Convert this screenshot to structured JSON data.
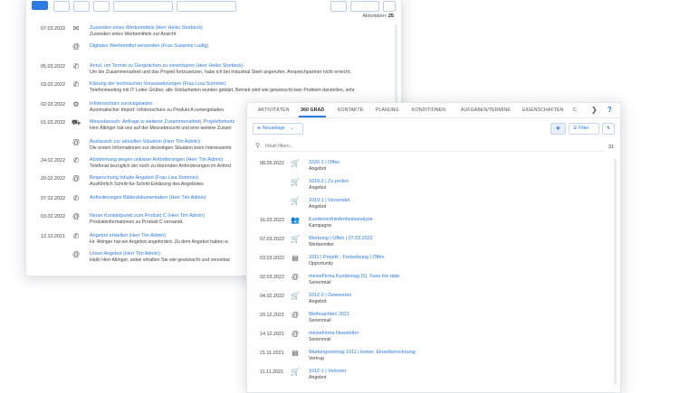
{
  "back_panel": {
    "count_label": "Aktivitäten:",
    "count_value": "25",
    "activities": [
      {
        "date": "07.03.2022",
        "icon": "mail-icon",
        "title": "Zusenden eines Werbemittels (Herr Heiko Storbeck)",
        "desc": "Zusenden eines Werbemittels zur Ansicht"
      },
      {
        "date": "",
        "icon": "at-icon",
        "title": "Digitales Werbemittel versenden (Frau Susanne Ludig)",
        "desc": ""
      },
      {
        "date": "05.03.2022",
        "icon": "phone-icon",
        "title": "Anruf, um Termin zu Gesprächen zu vereinbaren (Herr Heiko Storbeck)",
        "desc": "Um die Zusammenarbeit und das Projekt fortzusetzen, habe ich bei Industrial Steel angerufen.  Ansprechpartner nicht erreicht,"
      },
      {
        "date": "03.03.2022",
        "icon": "phone-icon",
        "title": "Klärung der technischen Voraussetzungen (Frau Lisa Sommer)",
        "desc": "Telefonmeeting mit IT Leiter Grüber, alle Unklarheiten wurden geklärt, Betrieb wird wie gewünscht kein Problem darstellen, sehr"
      },
      {
        "date": "02.03.2022",
        "icon": "settings-icon",
        "title": "Infobroschüre zurückgeladen",
        "desc": "Automatischer Import: Infobroschüre zu Produkt A runtergeladen."
      },
      {
        "date": "01.03.2022",
        "icon": "car-icon",
        "title": "Messebesuch: Anfrage w weiterer Zusammenarbeit, Projektfortsetz",
        "desc": "Herr Altinger hat uns auf der Messebesucht und eine weitere Zusam"
      },
      {
        "date": "",
        "icon": "at-icon",
        "title": "Austausch zur aktuellen Situation (Herr Tim Admin)",
        "desc": "Die ersten Informationen zur derzeitigen Situation beim Interessente"
      },
      {
        "date": "24.02.2022",
        "icon": "phone-icon",
        "title": "Abstimmung wegen unklarer Anforderungen (Herr Tim Admin)",
        "desc": "Telefonat bezüglich der noch zu klärenden Anforderungen im Anford"
      },
      {
        "date": "20.02.2022",
        "icon": "at-icon",
        "title": "Besprechung Inhalte Angebot (Frau Lisa Sommer)",
        "desc": "Ausführlich Schritt-für-Schritt-Erklärung des Angebotes"
      },
      {
        "date": "07.02.2022",
        "icon": "phone-icon",
        "title": "Anforderungen Bilderdokumentation (Herr Tim Admin)",
        "desc": ""
      },
      {
        "date": "03.02.2022",
        "icon": "at-icon",
        "title": "Neuer Kontaktpunkt zum Produkt C (Herr Tim Admin)",
        "desc": "Produktinformationen zu Produkt C versandt."
      },
      {
        "date": "12.12.2021",
        "icon": "phone-icon",
        "title": "Angebot erstellen (Herr Tim Admin)",
        "desc": "Hr. Altinger hat ein Angebot angefordert.  Zu dem Angebot haben w"
      },
      {
        "date": "",
        "icon": "at-icon",
        "title": "Unser Angebot (Herr Tim Admin)",
        "desc": "Hallo Herr Altinger, anbei erhalten Sie wie gewünscht und vereinbar"
      }
    ]
  },
  "front_panel": {
    "tabs": [
      "AKTIVITÄTEN",
      "360 GRAD",
      "KONTAKTE",
      "PLANUNG",
      "KONDITIONEN",
      "AUFGABEN/TERMINE",
      "EIGENSCHAFTEN",
      "C"
    ],
    "active_tab": "360 GRAD",
    "new_button": "Neuanlage",
    "filter_button": "Filter",
    "search_placeholder": "Inhalt filtern...",
    "result_count": "31",
    "records": [
      {
        "date": "08.05.2022",
        "icon": "cart-icon",
        "title": "1020-1 | Offen",
        "type": "Angebot"
      },
      {
        "date": "",
        "icon": "cart-icon",
        "title": "1019-2 | Zu prüfen",
        "type": "Angebot"
      },
      {
        "date": "",
        "icon": "cart-icon",
        "title": "1019-1 | Versendet",
        "type": "Angebot"
      },
      {
        "date": "16.03.2022",
        "icon": "people-icon",
        "title": "Kundenzufriedenheitsanalyse",
        "type": "Kampagne"
      },
      {
        "date": "07.03.2022",
        "icon": "cart-icon",
        "title": "Werbung | Offen | 07.03.2022",
        "type": "Werbemittel"
      },
      {
        "date": "03.03.2022",
        "icon": "document-icon",
        "title": "1011 | Projekt - Fortsetzung | Offen",
        "type": "Opportunity"
      },
      {
        "date": "02.03.2022",
        "icon": "at-icon",
        "title": "meineFirma Kundentag (5). Save the date",
        "type": "Serienmail"
      },
      {
        "date": "04.02.2022",
        "icon": "cart-icon",
        "title": "1012-2 | Gewonnen",
        "type": "Angebot"
      },
      {
        "date": "20.12.2021",
        "icon": "at-icon",
        "title": "Weihnachten 2021",
        "type": "Serienmail"
      },
      {
        "date": "14.12.2021",
        "icon": "at-icon",
        "title": "meineFirma Newsletter",
        "type": "Serienmail"
      },
      {
        "date": "21.11.2021",
        "icon": "document-icon",
        "title": "Wartungsvertrag 1011 | keiner, Einzelberechnung",
        "type": "Vertrag"
      },
      {
        "date": "11.11.2021",
        "icon": "cart-icon",
        "title": "1012-1 | Verloren",
        "type": "Angebot"
      }
    ]
  }
}
